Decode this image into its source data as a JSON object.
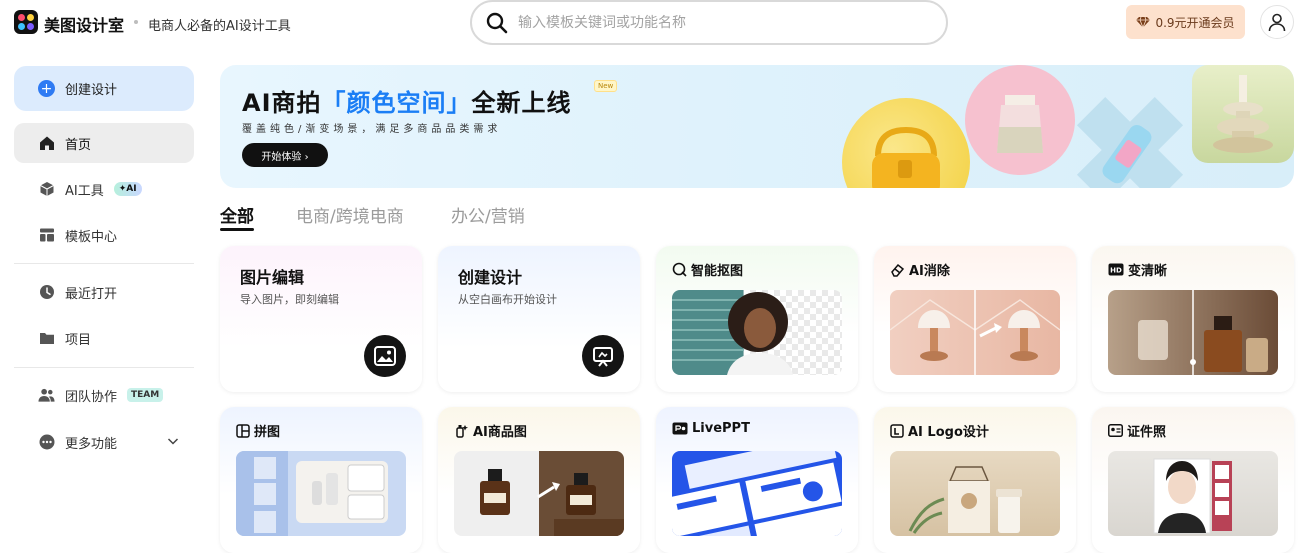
{
  "header": {
    "brand": "美图设计室",
    "tagline": "电商人必备的AI设计工具",
    "search_placeholder": "输入模板关键词或功能名称",
    "vip_label": "0.9元开通会员"
  },
  "sidebar": {
    "create_label": "创建设计",
    "items": [
      {
        "label": "首页",
        "icon": "home-icon",
        "active": true
      },
      {
        "label": "AI工具",
        "icon": "cube-icon",
        "badge": "✦AI"
      },
      {
        "label": "模板中心",
        "icon": "template-icon"
      },
      {
        "label": "最近打开",
        "icon": "clock-icon"
      },
      {
        "label": "项目",
        "icon": "folder-icon"
      },
      {
        "label": "团队协作",
        "icon": "team-icon",
        "badge": "TEAM"
      },
      {
        "label": "更多功能",
        "icon": "more-icon"
      }
    ]
  },
  "banner": {
    "title_pre": "AI商拍",
    "title_highlight": "「颜色空间」",
    "title_post": "全新上线",
    "new_badge": "New",
    "subtitle": "覆盖纯色/渐变场景，满足多商品品类需求",
    "button_label": "开始体验 ›"
  },
  "tabs": [
    "全部",
    "电商/跨境电商",
    "办公/营销"
  ],
  "cards": [
    {
      "title": "图片编辑",
      "subtitle": "导入图片，即刻编辑",
      "icon": "image-icon"
    },
    {
      "title": "创建设计",
      "subtitle": "从空白画布开始设计",
      "icon": "canvas-icon"
    },
    {
      "title": "智能抠图",
      "icon": "cutout-icon"
    },
    {
      "title": "AI消除",
      "icon": "eraser-icon"
    },
    {
      "title": "变清晰",
      "icon": "hd-icon"
    },
    {
      "title": "拼图",
      "icon": "collage-icon"
    },
    {
      "title": "AI商品图",
      "icon": "product-icon"
    },
    {
      "title": "LivePPT",
      "icon": "ppt-icon"
    },
    {
      "title": "AI Logo设计",
      "icon": "logo-icon"
    },
    {
      "title": "证件照",
      "icon": "id-photo-icon"
    }
  ],
  "colors": {
    "accent": "#2f7bf3",
    "banner_highlight": "#1b7ef5",
    "vip_bg": "#fde1cd"
  }
}
